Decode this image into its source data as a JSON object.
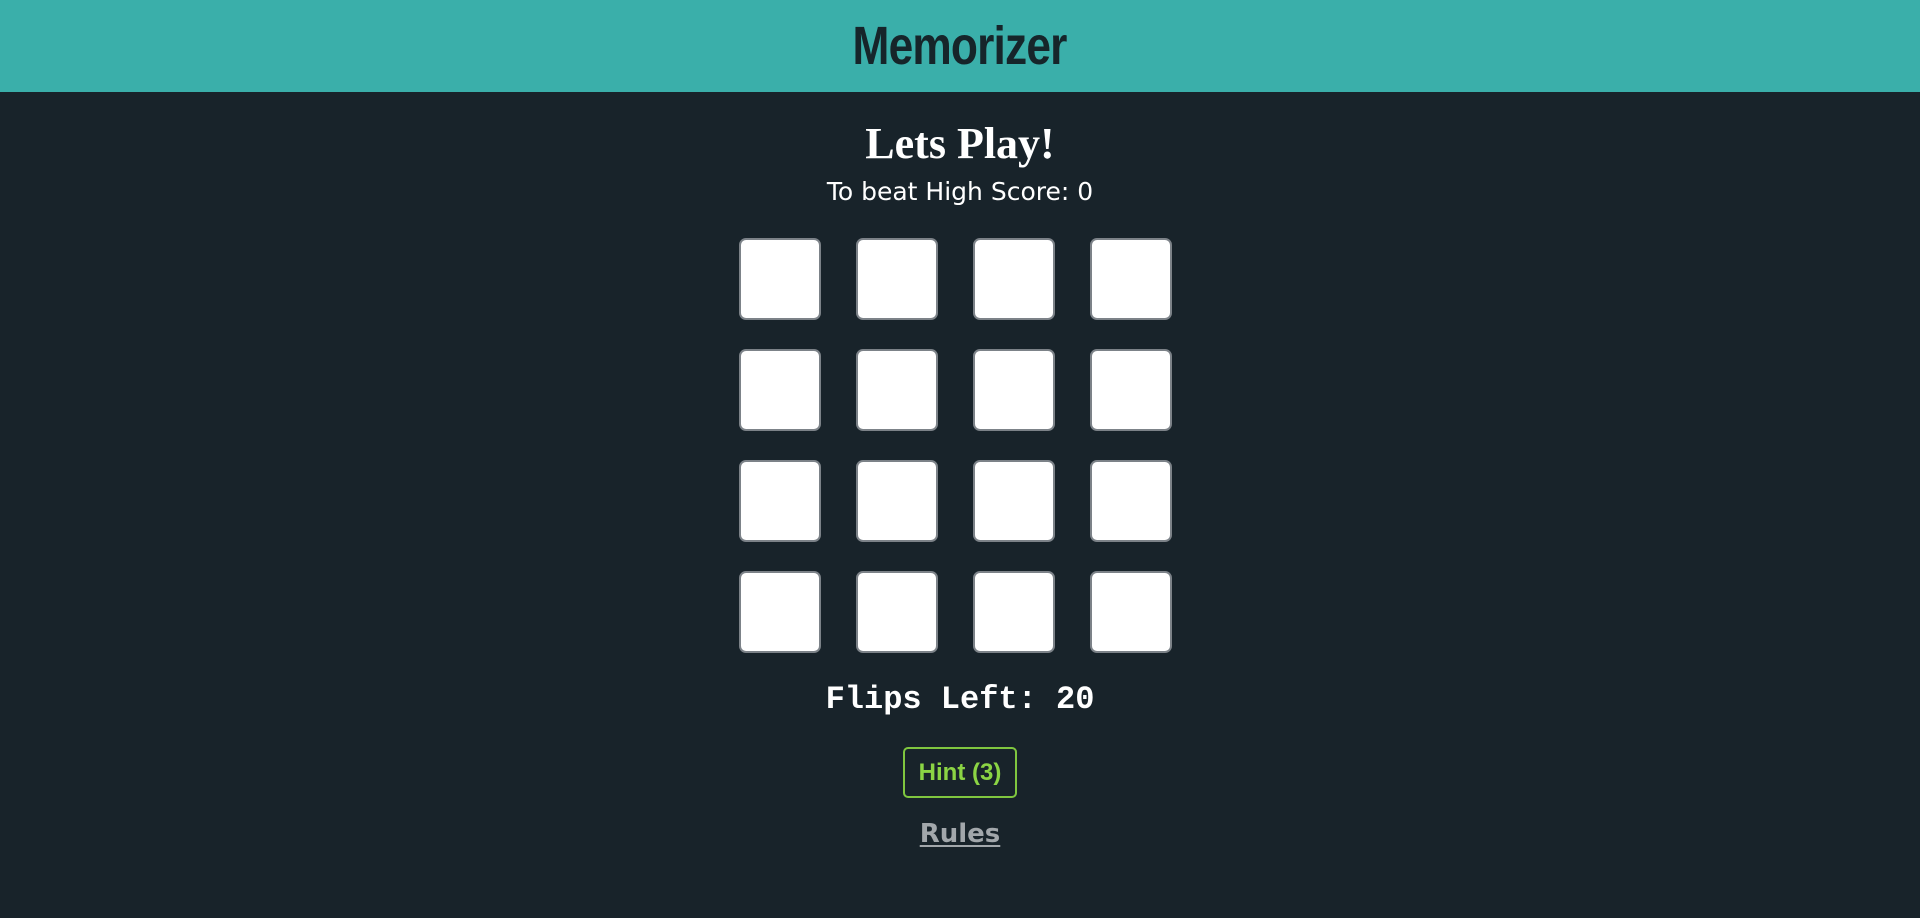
{
  "app": {
    "title": "Memorizer"
  },
  "game": {
    "heading": "Lets Play!",
    "high_score_text": "To beat High Score: 0",
    "flips_left_text": "Flips Left: 20",
    "hint_label": "Hint (3)",
    "rules_label": "Rules"
  },
  "board": {
    "rows": 4,
    "columns": 4,
    "cards": [
      {
        "state": "face-down"
      },
      {
        "state": "face-down"
      },
      {
        "state": "face-down"
      },
      {
        "state": "face-down"
      },
      {
        "state": "face-down"
      },
      {
        "state": "face-down"
      },
      {
        "state": "face-down"
      },
      {
        "state": "face-down"
      },
      {
        "state": "face-down"
      },
      {
        "state": "face-down"
      },
      {
        "state": "face-down"
      },
      {
        "state": "face-down"
      },
      {
        "state": "face-down"
      },
      {
        "state": "face-down"
      },
      {
        "state": "face-down"
      },
      {
        "state": "face-down"
      }
    ]
  },
  "colors": {
    "header_bg": "#3aafaa",
    "page_bg": "#18232a",
    "hint_green": "#8bd444",
    "card_bg": "#ffffff",
    "rules_gray": "#a2a7ab"
  }
}
